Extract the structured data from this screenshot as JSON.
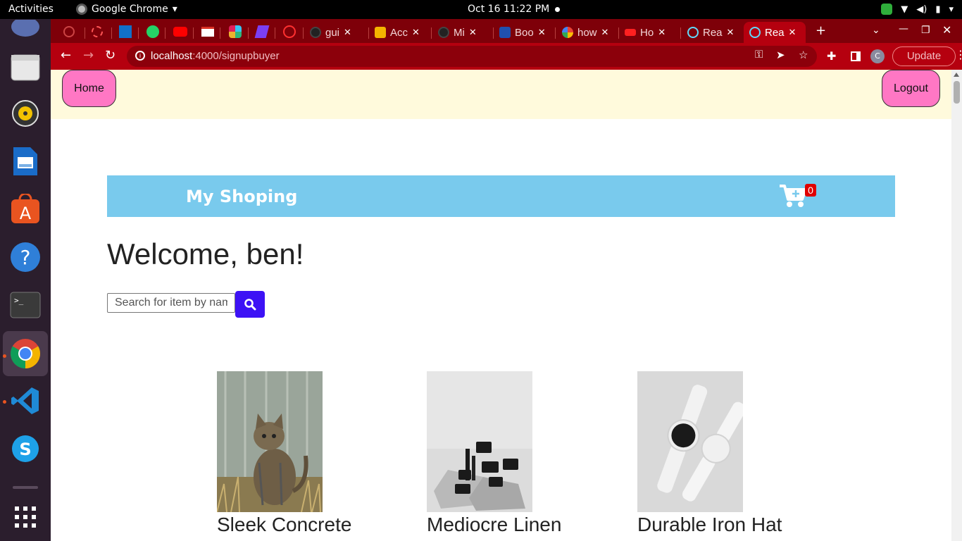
{
  "system_bar": {
    "activities": "Activities",
    "app_name": "Google Chrome",
    "clock": "Oct 16  11:22 PM"
  },
  "dock": {
    "items": [
      "firefox",
      "files",
      "rhythmbox",
      "libreoffice-writer",
      "software",
      "help",
      "terminal",
      "google-chrome",
      "vscode",
      "skype",
      "show-apps"
    ]
  },
  "browser": {
    "tabs": [
      {
        "label": "gui",
        "favicon": "github"
      },
      {
        "label": "Acc",
        "favicon": "slides"
      },
      {
        "label": "Mi",
        "favicon": "github"
      },
      {
        "label": "Boo",
        "favicon": "mdb"
      },
      {
        "label": "how",
        "favicon": "google"
      },
      {
        "label": "Ho",
        "favicon": "youtube-red"
      },
      {
        "label": "Rea",
        "favicon": "react"
      },
      {
        "label": "Rea",
        "favicon": "react",
        "active": true
      }
    ],
    "url_host": "localhost",
    "url_path": ":4000/signupbuyer",
    "profile_initial": "C",
    "update_label": "Update"
  },
  "page": {
    "nav": {
      "home_label": "Home",
      "logout_label": "Logout"
    },
    "brand": "My Shoping",
    "cart_count": "0",
    "welcome": "Welcome, ben!",
    "search": {
      "placeholder": "Search for item by name",
      "value": ""
    },
    "products": [
      {
        "name": "Sleek Concrete",
        "image": "kitten photo"
      },
      {
        "name": "Mediocre Linen",
        "image": "cosmetics jars on stone"
      },
      {
        "name": "Durable Iron Hat",
        "image": "white smartwatches"
      }
    ]
  },
  "colors": {
    "nav_bg": "#fffadc",
    "nav_button": "#ff77c4",
    "banner": "#79caed",
    "search_button": "#3d12f5",
    "cart_badge": "#e00000",
    "chrome_frame": "#b5000f"
  }
}
